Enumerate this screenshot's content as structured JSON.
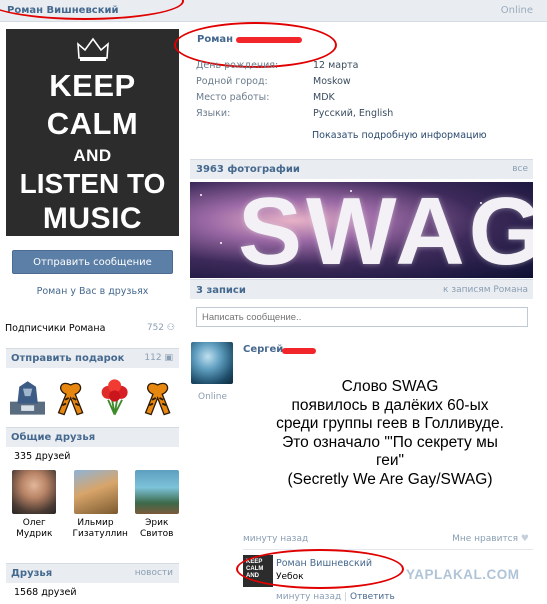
{
  "header": {
    "user_name": "Роман Вишневский",
    "status": "Online"
  },
  "avatar": {
    "lines": [
      "KEEP",
      "CALM",
      "AND",
      "LISTEN TO",
      "MUSIC"
    ]
  },
  "actions": {
    "send_message": "Отправить сообщение",
    "friend_status": "Роман у Вас в друзьях"
  },
  "subscribers": {
    "label": "Подписчики Романа",
    "count": "752"
  },
  "gifts": {
    "title": "Отправить подарок",
    "count": "112"
  },
  "mutual_friends": {
    "title": "Общие друзья",
    "count_text": "335 друзей",
    "items": [
      {
        "first": "Олег",
        "last": "Мудрик"
      },
      {
        "first": "Ильмир",
        "last": "Гизатуллин"
      },
      {
        "first": "Эрик",
        "last": "Свитов"
      }
    ]
  },
  "friends": {
    "title": "Друзья",
    "news_link": "новости",
    "count_text": "1568 друзей"
  },
  "profile": {
    "name_visible": "Роман",
    "info": [
      {
        "key": "День рождения:",
        "value": "12 марта"
      },
      {
        "key": "Родной город:",
        "value": "Moskow"
      },
      {
        "key": "Место работы:",
        "value": "MDK"
      },
      {
        "key": "Языки:",
        "value": "Русский, English"
      }
    ],
    "show_more": "Показать подробную информацию"
  },
  "photos": {
    "title": "3963 фотографии",
    "all_link": "все",
    "banner_text": "SWAG"
  },
  "wall": {
    "title": "3 записи",
    "link": "к записям Романа",
    "placeholder": "Написать сообщение.."
  },
  "post": {
    "author": "Сергей",
    "online": "Online",
    "text_lines": [
      "Слово SWAG",
      "появилось в далёких 60-ых",
      "среди группы геев в Голливуде.",
      "Это означало \"'По секрету мы",
      "геи\"",
      "(Secretly We Are Gay/SWAG)"
    ],
    "time": "минуту назад",
    "like": "Мне нравится",
    "comment": {
      "author": "Роман Вишневский",
      "text": "Уебок",
      "time": "минуту назад",
      "reply": "Ответить",
      "avatar_lines": [
        "KEEP",
        "CALM",
        "AND"
      ]
    }
  },
  "watermark": "YAPLAKAL.COM",
  "colors": {
    "link": "#45688e",
    "highlight_ellipse": "#e00000",
    "scribble": "#f2262a",
    "button": "#5b7fa6"
  }
}
